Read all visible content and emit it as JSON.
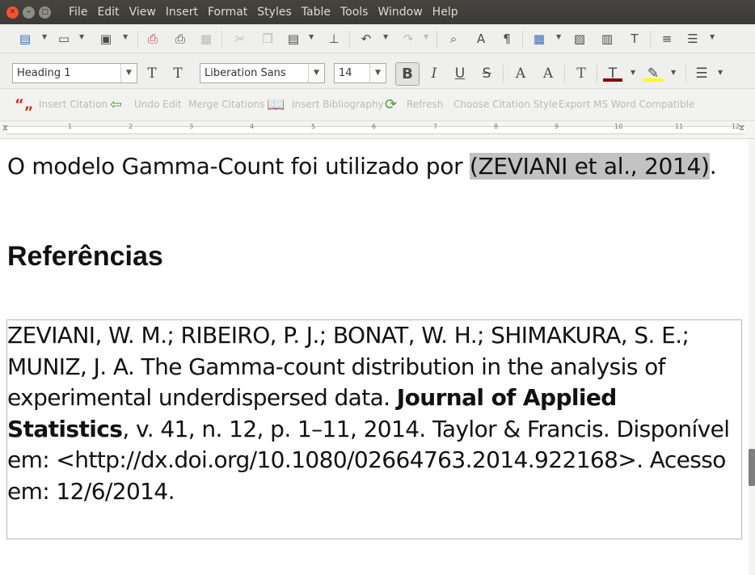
{
  "window": {
    "menu": [
      "File",
      "Edit",
      "View",
      "Insert",
      "Format",
      "Styles",
      "Table",
      "Tools",
      "Window",
      "Help"
    ]
  },
  "toolbar_format": {
    "paragraph_style": "Heading 1",
    "font_name": "Liberation Sans",
    "font_size": "14"
  },
  "zotero_toolbar": {
    "insert_citation": "Insert Citation",
    "undo_edit": "Undo Edit",
    "merge_citations": "Merge Citations",
    "insert_bibliography": "Insert Bibliography",
    "refresh": "Refresh",
    "choose_citation_style": "Choose Citation Style",
    "export_ms_word": "Export MS Word Compatible"
  },
  "ruler": {
    "numbers": [
      "1",
      "2",
      "3",
      "4",
      "5",
      "6",
      "7",
      "8",
      "9",
      "10",
      "11",
      "12"
    ]
  },
  "document": {
    "sentence_prefix": "O modelo Gamma-Count foi utilizado por ",
    "citation": "(ZEVIANI et al., 2014)",
    "sentence_suffix": ".",
    "heading": "Referências",
    "reference": {
      "authors_and_title": "ZEVIANI, W. M.; RIBEIRO, P. J.; BONAT, W. H.; SHIMAKURA, S. E.; MUNIZ, J. A. The Gamma-count distribution in the analysis of experimental underdispersed data. ",
      "journal": "Journal of Applied Statistics",
      "details": ", v. 41, n. 12, p. 1–11, 2014. Taylor & Francis. Disponível em: <http://dx.doi.org/10.1080/02664763.2014.922168>. Acesso em: 12/6/2014."
    }
  },
  "colors": {
    "menubar": "#3f3e3a",
    "citation_highlight": "#c2c2c2",
    "font_color_bar": "#c00000",
    "highlight_color_bar": "#ffff00"
  }
}
